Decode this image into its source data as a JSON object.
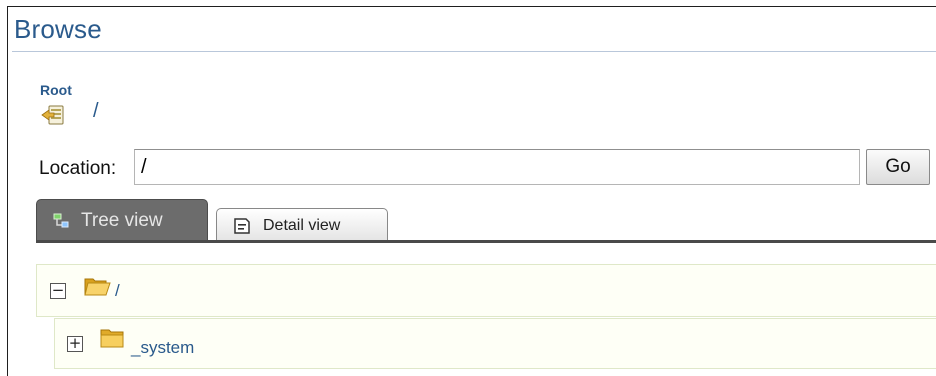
{
  "page": {
    "title": "Browse"
  },
  "breadcrumb": {
    "root_label": "Root",
    "path": "/"
  },
  "location": {
    "label": "Location:",
    "value": "/",
    "go_label": "Go"
  },
  "tabs": [
    {
      "label": "Tree view",
      "active": true,
      "icon": "tree-view-icon"
    },
    {
      "label": "Detail view",
      "active": false,
      "icon": "detail-view-icon"
    }
  ],
  "tree": {
    "nodes": [
      {
        "label": "/",
        "state": "expanded",
        "toggle": "−",
        "icon": "folder-open-icon"
      },
      {
        "label": "_system",
        "state": "collapsed",
        "toggle": "+",
        "icon": "folder-icon"
      }
    ]
  },
  "colors": {
    "accent": "#2a5a8c",
    "tab_active": "#6c6c6c",
    "tree_row_bg": "#fefff6"
  }
}
